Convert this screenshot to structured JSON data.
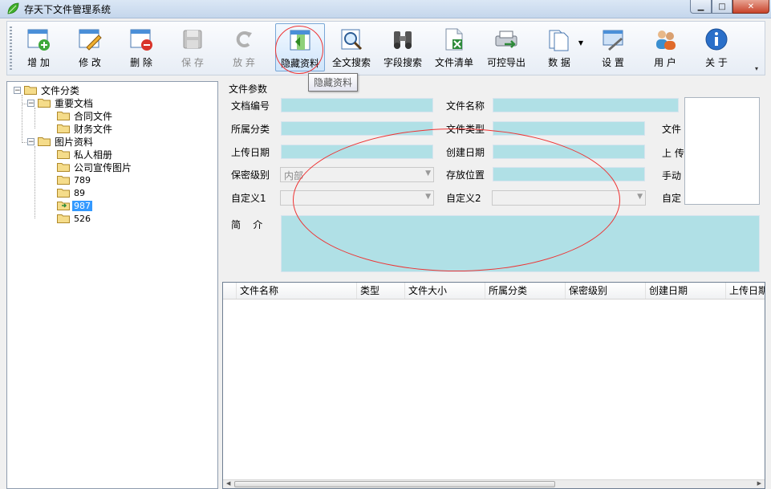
{
  "window": {
    "title": "存天下文件管理系统"
  },
  "toolbar": {
    "buttons": [
      {
        "label": "增 加",
        "icon": "add-form-icon",
        "disabled": false
      },
      {
        "label": "修 改",
        "icon": "edit-form-icon",
        "disabled": false
      },
      {
        "label": "删 除",
        "icon": "delete-form-icon",
        "disabled": false
      },
      {
        "label": "保 存",
        "icon": "floppy-disk-icon",
        "disabled": true
      },
      {
        "label": "放 弃",
        "icon": "undo-icon",
        "disabled": true
      },
      {
        "label": "隐藏资料",
        "icon": "hide-data-icon",
        "disabled": false,
        "hovered": true
      },
      {
        "label": "全文搜索",
        "icon": "magnifier-icon",
        "disabled": false
      },
      {
        "label": "字段搜索",
        "icon": "binoculars-icon",
        "disabled": false
      },
      {
        "label": "文件清单",
        "icon": "excel-list-icon",
        "disabled": false
      },
      {
        "label": "可控导出",
        "icon": "export-icon",
        "disabled": false
      },
      {
        "label": "数 据",
        "icon": "data-document-icon",
        "disabled": false
      },
      {
        "label": "设 置",
        "icon": "settings-icon",
        "disabled": false
      },
      {
        "label": "用 户",
        "icon": "users-icon",
        "disabled": false
      },
      {
        "label": "关 于",
        "icon": "info-icon",
        "disabled": false
      }
    ],
    "tooltip": "隐藏资料"
  },
  "tree": {
    "root": "文件分类",
    "nodes": [
      {
        "label": "重要文档"
      },
      {
        "label": "合同文件"
      },
      {
        "label": "财务文件"
      },
      {
        "label": "图片资料"
      },
      {
        "label": "私人相册"
      },
      {
        "label": "公司宣传图片"
      },
      {
        "label": "789"
      },
      {
        "label": "89"
      },
      {
        "label": "987",
        "selected": true
      },
      {
        "label": "526"
      }
    ]
  },
  "params": {
    "group_title": "文件参数",
    "labels": {
      "doc_no": "文档编号",
      "file_name": "文件名称",
      "category": "所属分类",
      "file_type": "文件类型",
      "file_size_cut": "文件",
      "upload_date": "上传日期",
      "create_date": "创建日期",
      "upload_cut": "上 传",
      "secrecy": "保密级别",
      "location": "存放位置",
      "manual_cut": "手动",
      "custom1": "自定义1",
      "custom2": "自定义2",
      "custom_cut": "自定",
      "intro": "简    介"
    },
    "secrecy_value": "内部",
    "custom1_value": "",
    "custom2_value": ""
  },
  "grid": {
    "columns": [
      "文件名称",
      "类型",
      "文件大小",
      "所属分类",
      "保密级别",
      "创建日期",
      "上传日期"
    ]
  },
  "colors": {
    "input_bg": "#b0e0e6",
    "selection": "#3399ff",
    "annotation": "#e33333"
  }
}
